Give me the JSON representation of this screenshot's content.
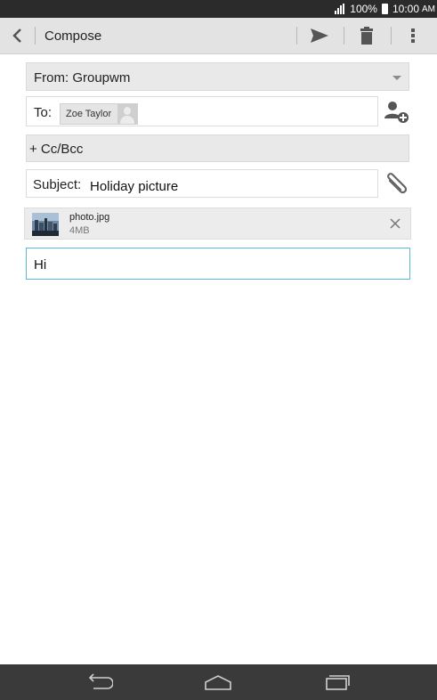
{
  "status_bar": {
    "battery": "100%",
    "time": "10:00",
    "ampm": "AM"
  },
  "action_bar": {
    "title": "Compose",
    "icons": [
      "back-icon",
      "send-icon",
      "delete-icon",
      "overflow-menu-icon"
    ]
  },
  "form": {
    "from_label": "From: Groupwm",
    "to_label": "To:",
    "recipient": "Zoe Taylor",
    "cc_label": "+ Cc/Bcc",
    "subject_label": "Subject:",
    "subject_value": "Holiday picture",
    "body_text": "Hi"
  },
  "attachment": {
    "name": "photo.jpg",
    "size": "4MB"
  },
  "colors": {
    "accent": "#59b9d6",
    "status_bar": "#2b2b2b",
    "nav_bar": "#3a3a3a",
    "action_bar": "#e3e3e3"
  }
}
